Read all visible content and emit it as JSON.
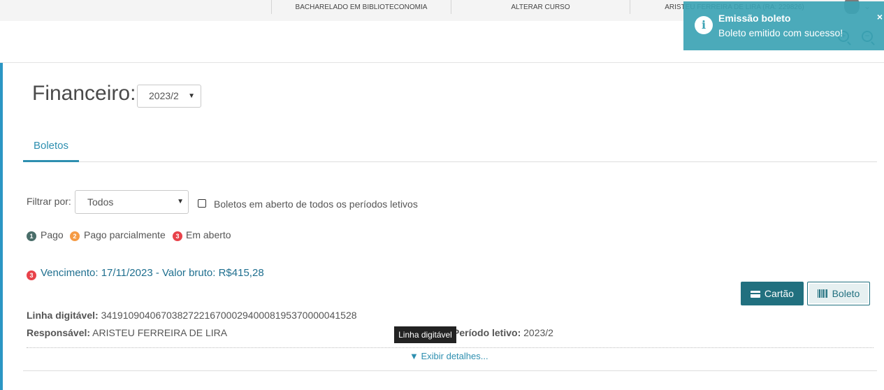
{
  "topbar": {
    "course": "BACHARELADO EM BIBLIOTECONOMIA",
    "change_course": "ALTERAR CURSO",
    "user": "ARISTEU FERREIRA DE LIRA (RA: 229826)"
  },
  "page": {
    "title": "Financeiro:",
    "period": "2023/2"
  },
  "tabs": [
    {
      "label": "Boletos",
      "active": true
    }
  ],
  "filter": {
    "label": "Filtrar por:",
    "selected": "Todos",
    "checkbox_label": "Boletos em aberto de todos os períodos letivos",
    "checkbox_checked": false
  },
  "legend": [
    {
      "num": "1",
      "label": "Pago",
      "color": "#4a6e6a"
    },
    {
      "num": "2",
      "label": "Pago parcialmente",
      "color": "#f59b45"
    },
    {
      "num": "3",
      "label": "Em aberto",
      "color": "#e8424a"
    }
  ],
  "boleto": {
    "status_num": "3",
    "due_text": "Vencimento: 17/11/2023 - Valor bruto: R$415,28",
    "card_button": "Cartão",
    "boleto_button": "Boleto",
    "linha_label": "Linha digitável:",
    "linha_value": "34191090406703827221670002940008195370000041528",
    "resp_label": "Responsável:",
    "resp_value": "ARISTEU FERREIRA DE LIRA",
    "periodo_label": "Período letivo:",
    "periodo_value": "2023/2",
    "details_link": "▼ Exibir detalhes..."
  },
  "tooltip": "Linha digitável",
  "toast": {
    "title": "Emissão boleto",
    "message": "Boleto emitido com sucesso!",
    "close": "×"
  },
  "icons": {
    "info": "info-icon",
    "zoom_in": "zoom-in-icon",
    "zoom_out": "zoom-out-icon",
    "card": "credit-card-icon",
    "barcode": "barcode-icon"
  },
  "colors": {
    "accent": "#2e8fb0",
    "button": "#21707f",
    "toast": "#3ca3b4",
    "paid": "#4a6e6a",
    "partial": "#f59b45",
    "open": "#e8424a"
  }
}
